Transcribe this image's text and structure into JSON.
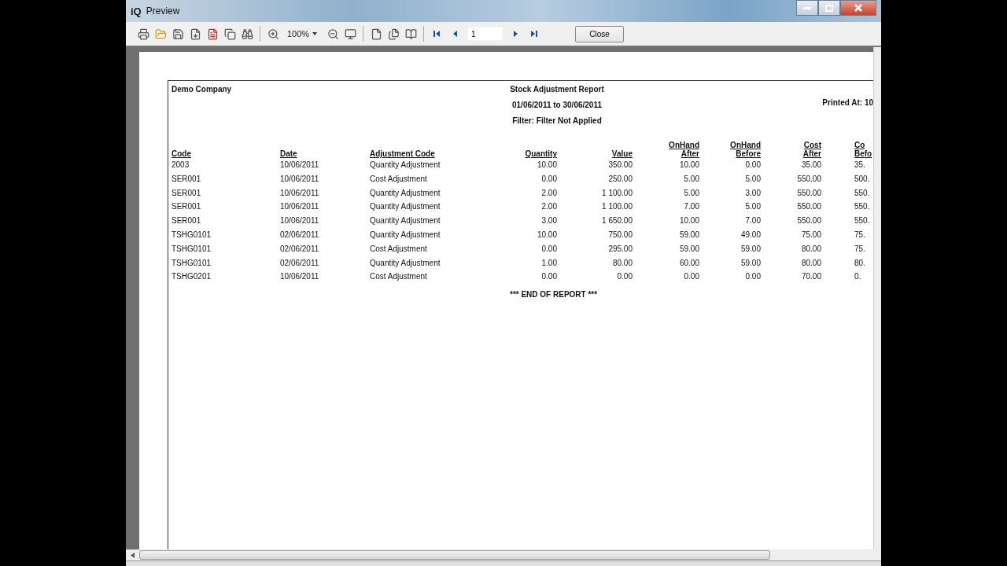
{
  "window": {
    "logo": "iQ",
    "title": "Preview"
  },
  "toolbar": {
    "zoom": "100%",
    "page": "1",
    "close_button": "Close"
  },
  "report": {
    "company": "Demo Company",
    "title": "Stock Adjustment Report",
    "period": "01/06/2011 to 30/06/2011",
    "filter": "Filter: Filter Not Applied",
    "printed_at": "Printed At: 10",
    "columns": [
      "Code",
      "Date",
      "Adjustment Code",
      "Quantity",
      "Value",
      "OnHand\nAfter",
      "OnHand\nBefore",
      "Cost\nAfter",
      "Co\nBefo"
    ],
    "rows": [
      [
        "2003",
        "10/06/2011",
        "Quantity Adjustment",
        "10.00",
        "350.00",
        "10.00",
        "0.00",
        "35.00",
        "35."
      ],
      [
        "SER001",
        "10/06/2011",
        "Cost Adjustment",
        "0.00",
        "250.00",
        "5.00",
        "5.00",
        "550.00",
        "500."
      ],
      [
        "SER001",
        "10/06/2011",
        "Quantity Adjustment",
        "2.00",
        "1 100.00",
        "5.00",
        "3.00",
        "550.00",
        "550."
      ],
      [
        "SER001",
        "10/06/2011",
        "Quantity Adjustment",
        "2.00",
        "1 100.00",
        "7.00",
        "5.00",
        "550.00",
        "550."
      ],
      [
        "SER001",
        "10/06/2011",
        "Quantity Adjustment",
        "3.00",
        "1 650.00",
        "10.00",
        "7.00",
        "550.00",
        "550."
      ],
      [
        "TSHG0101",
        "02/06/2011",
        "Quantity Adjustment",
        "10.00",
        "750.00",
        "59.00",
        "49.00",
        "75.00",
        "75."
      ],
      [
        "TSHG0101",
        "02/06/2011",
        "Cost Adjustment",
        "0.00",
        "295.00",
        "59.00",
        "59.00",
        "80.00",
        "75."
      ],
      [
        "TSHG0101",
        "02/06/2011",
        "Quantity Adjustment",
        "1.00",
        "80.00",
        "60.00",
        "59.00",
        "80.00",
        "80."
      ],
      [
        "TSHG0201",
        "10/06/2011",
        "Cost Adjustment",
        "0.00",
        "0.00",
        "0.00",
        "0.00",
        "70.00",
        "0."
      ]
    ],
    "footer": "*** END OF REPORT ***"
  }
}
